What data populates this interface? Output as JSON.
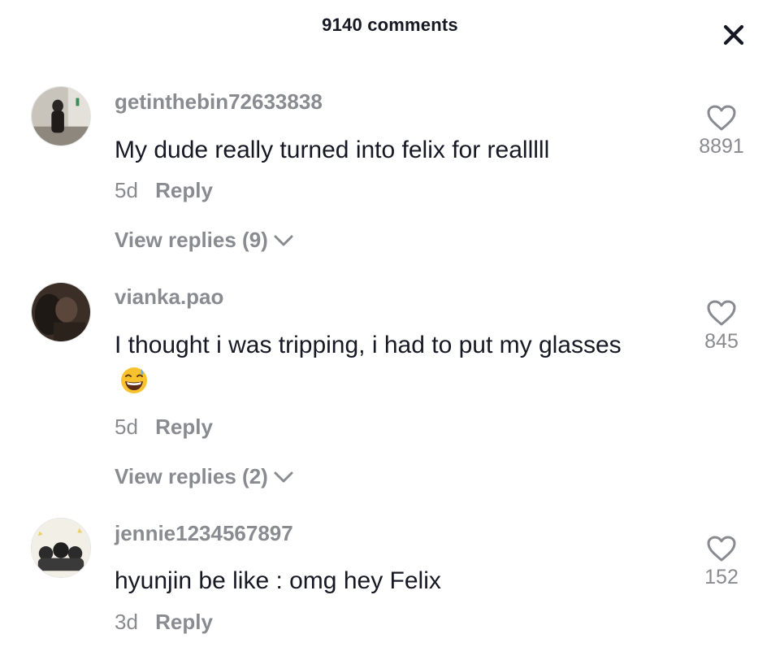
{
  "header": {
    "title": "9140 comments"
  },
  "comments": [
    {
      "username": "getinthebin72633838",
      "text": "My dude really turned into felix for realllll",
      "time": "5d",
      "reply_label": "Reply",
      "likes": "8891",
      "view_replies": "View replies (9)"
    },
    {
      "username": "vianka.pao",
      "text": "I thought i was tripping, i had to put my glasses",
      "emoji": "grinning-sweat-emoji",
      "time": "5d",
      "reply_label": "Reply",
      "likes": "845",
      "view_replies": "View replies (2)"
    },
    {
      "username": "jennie1234567897",
      "text": "hyunjin be like : omg hey Felix",
      "time": "3d",
      "reply_label": "Reply",
      "likes": "152"
    }
  ],
  "icons": {
    "close": "close-icon",
    "like": "heart-outline-icon",
    "expand": "chevron-down-icon"
  },
  "colors": {
    "primary_text": "#161823",
    "secondary_text": "#8a8b91",
    "background": "#ffffff"
  }
}
